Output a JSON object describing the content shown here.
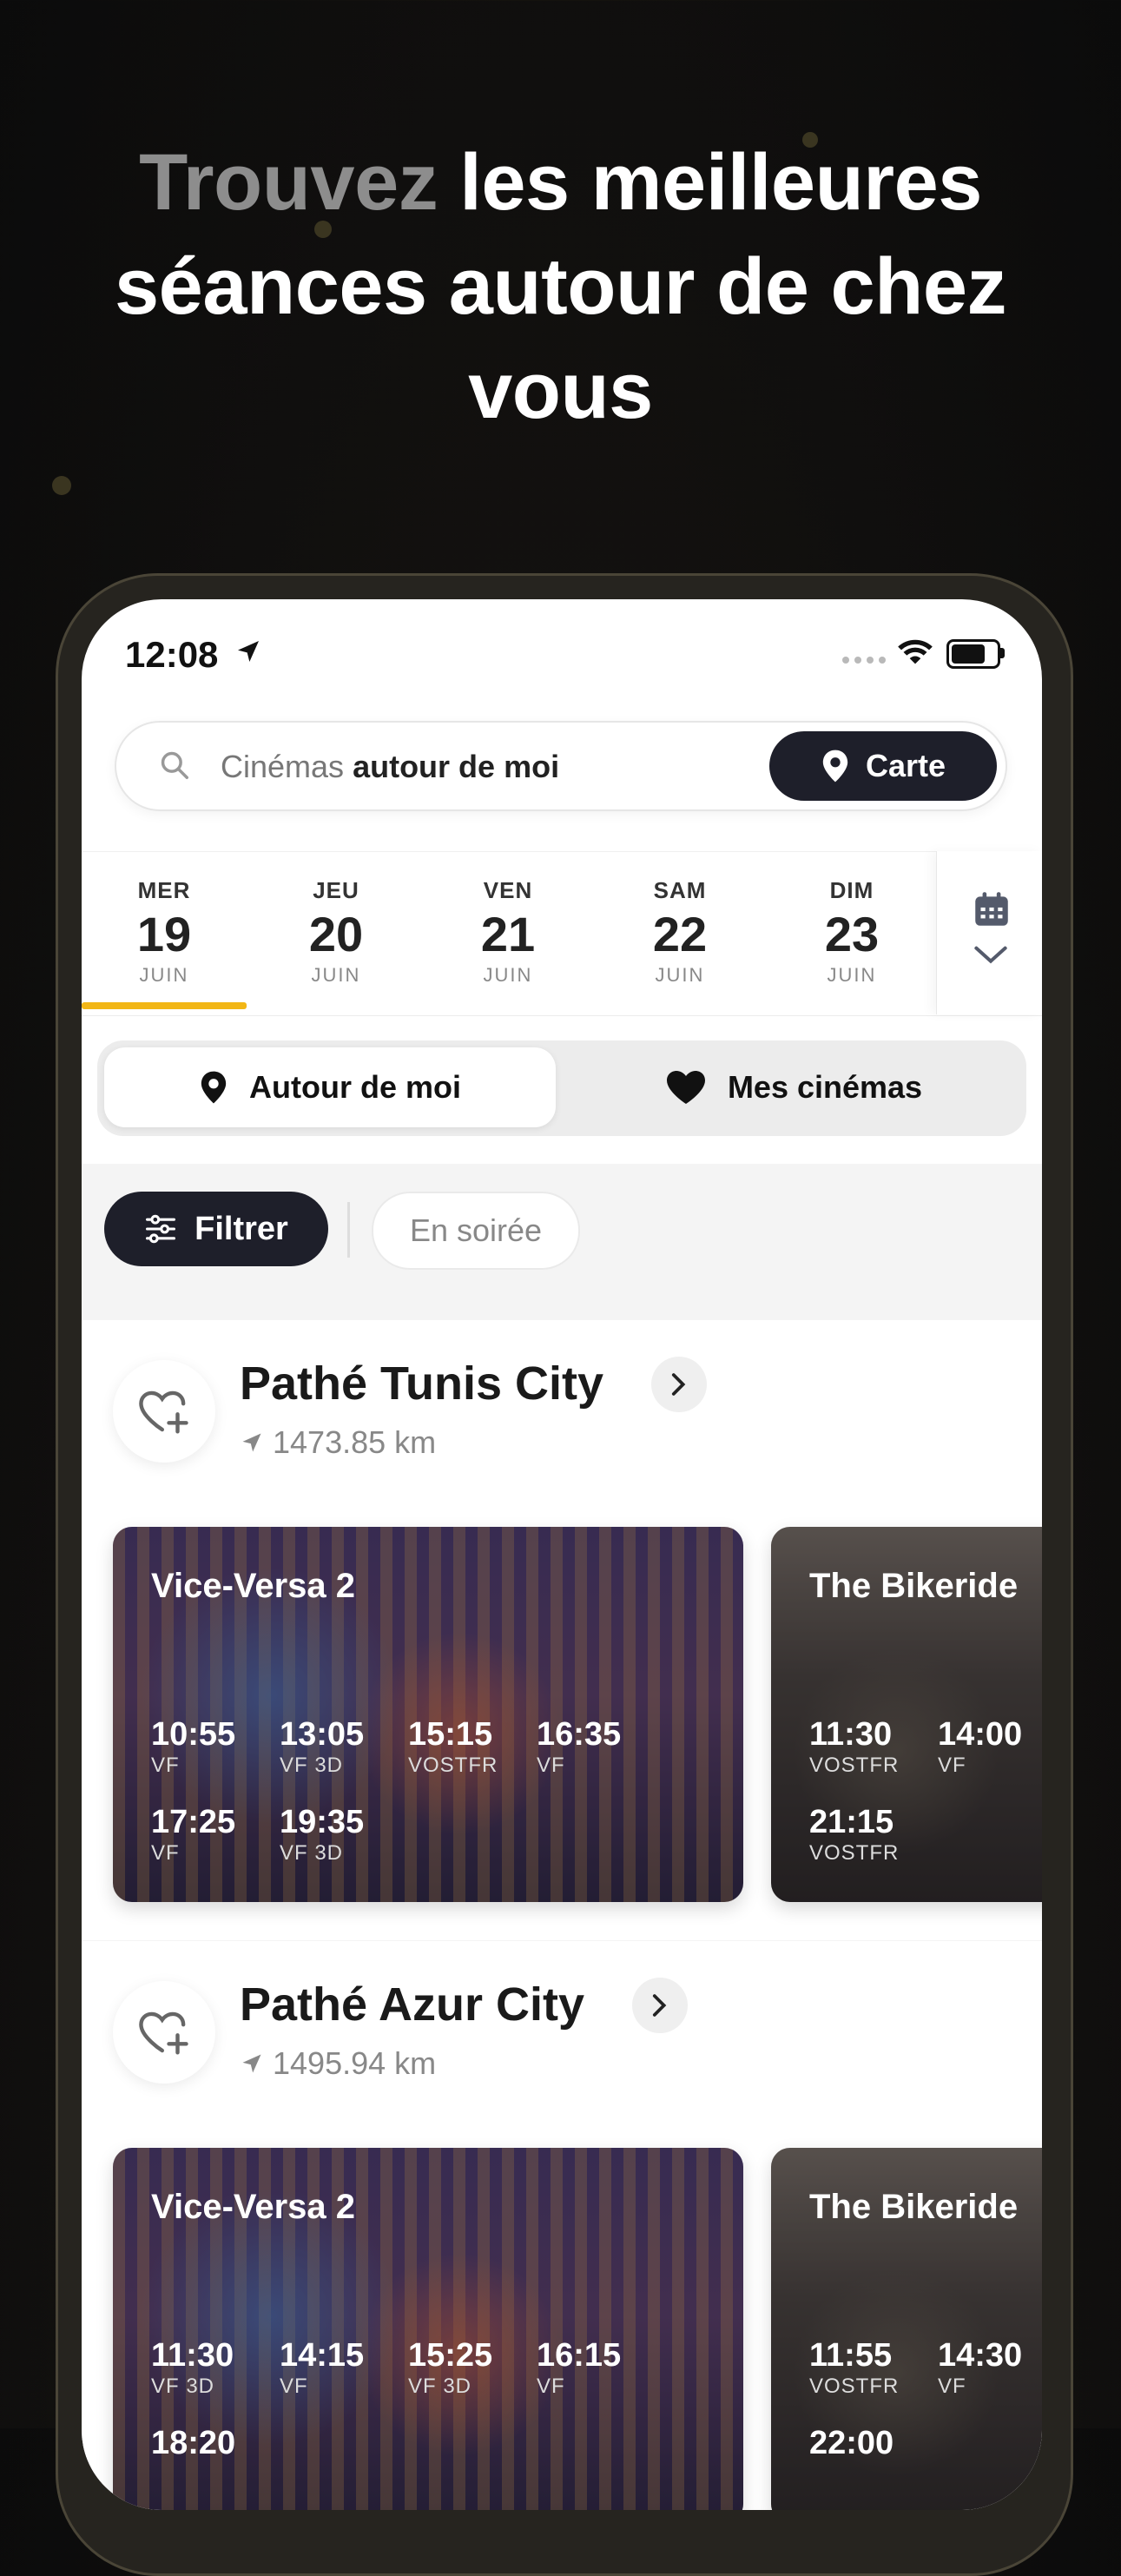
{
  "headline": {
    "muted": "Trouvez",
    "line1_rest": " les meilleures",
    "line2": "séances autour de chez",
    "line3": "vous"
  },
  "status_bar": {
    "time": "12:08"
  },
  "search": {
    "prefix": "Cinémas ",
    "bold": "autour de moi",
    "map_button": "Carte"
  },
  "dates": [
    {
      "dow": "MER",
      "num": "19",
      "month": "JUIN",
      "selected": true
    },
    {
      "dow": "JEU",
      "num": "20",
      "month": "JUIN"
    },
    {
      "dow": "VEN",
      "num": "21",
      "month": "JUIN"
    },
    {
      "dow": "SAM",
      "num": "22",
      "month": "JUIN"
    },
    {
      "dow": "DIM",
      "num": "23",
      "month": "JUIN"
    }
  ],
  "segments": {
    "active": "Autour de moi",
    "inactive": "Mes cinémas"
  },
  "filters": {
    "filter_button": "Filtrer",
    "chip": "En soirée"
  },
  "accent_color": "#f2b615",
  "cinemas": [
    {
      "name": "Pathé Tunis City",
      "distance": "1473.85 km",
      "movies": [
        {
          "title": "Vice-Versa 2",
          "showtimes": [
            {
              "time": "10:55",
              "version": "VF"
            },
            {
              "time": "13:05",
              "version": "VF 3D"
            },
            {
              "time": "15:15",
              "version": "VOSTFR"
            },
            {
              "time": "16:35",
              "version": "VF"
            },
            {
              "time": "17:25",
              "version": "VF"
            },
            {
              "time": "19:35",
              "version": "VF 3D"
            }
          ]
        },
        {
          "title": "The Bikeride",
          "showtimes": [
            {
              "time": "11:30",
              "version": "VOSTFR"
            },
            {
              "time": "14:00",
              "version": "VF"
            },
            {
              "time": "21:15",
              "version": "VOSTFR"
            }
          ]
        }
      ]
    },
    {
      "name": "Pathé Azur City",
      "distance": "1495.94 km",
      "movies": [
        {
          "title": "Vice-Versa 2",
          "showtimes": [
            {
              "time": "11:30",
              "version": "VF 3D"
            },
            {
              "time": "14:15",
              "version": "VF"
            },
            {
              "time": "15:25",
              "version": "VF 3D"
            },
            {
              "time": "16:15",
              "version": "VF"
            },
            {
              "time": "18:20",
              "version": ""
            }
          ]
        },
        {
          "title": "The Bikeride",
          "showtimes": [
            {
              "time": "11:55",
              "version": "VOSTFR"
            },
            {
              "time": "14:30",
              "version": "VF"
            },
            {
              "time": "22:00",
              "version": ""
            }
          ]
        }
      ]
    }
  ]
}
